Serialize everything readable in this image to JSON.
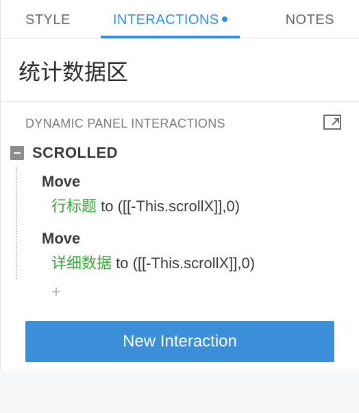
{
  "tabs": {
    "style": "STYLE",
    "interactions": "INTERACTIONS",
    "notes": "NOTES",
    "active": "interactions",
    "has_indicator": true
  },
  "title": "统计数据区",
  "section_label": "DYNAMIC PANEL INTERACTIONS",
  "event": {
    "name": "SCROLLED",
    "actions": [
      {
        "type": "Move",
        "target": "行标题",
        "params": "to ([[-This.scrollX]],0)"
      },
      {
        "type": "Move",
        "target": "详细数据",
        "params": "to ([[-This.scrollX]],0)"
      }
    ]
  },
  "add_label": "+",
  "new_button": "New Interaction"
}
